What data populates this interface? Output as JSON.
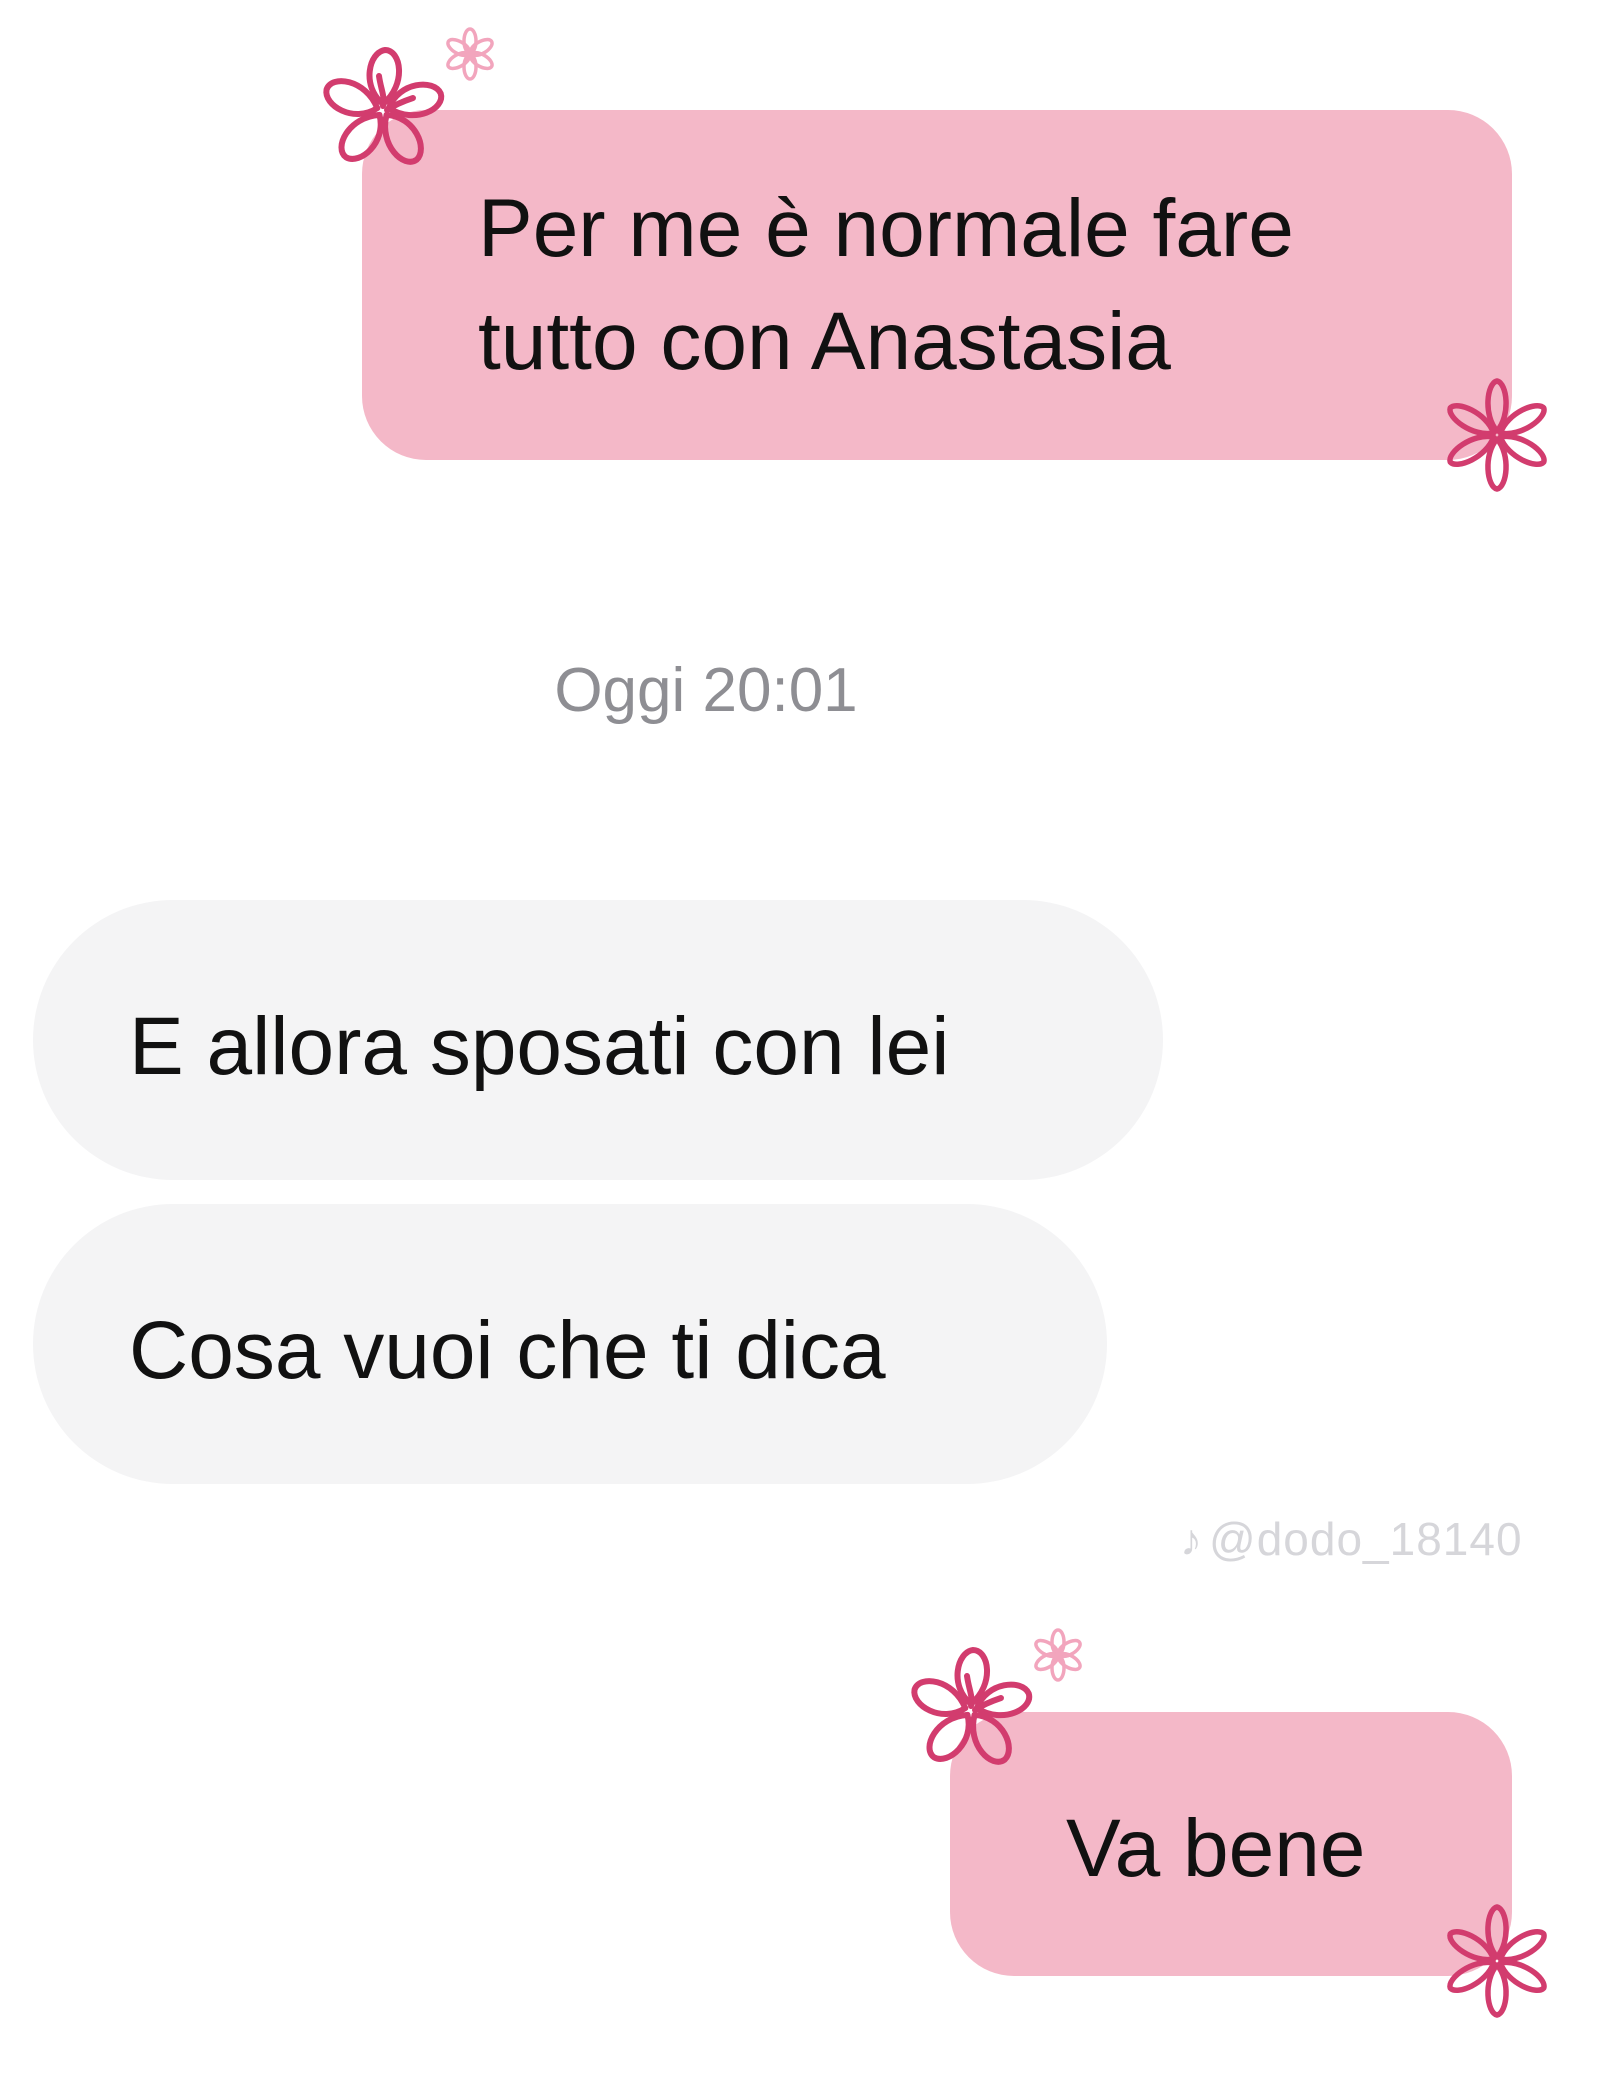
{
  "colors": {
    "outgoing_bubble": "#f4b8c8",
    "incoming_bubble": "#f4f4f5",
    "flower_dark": "#d23c6e",
    "flower_light": "#f2a5bd",
    "timestamp": "#8e8e93",
    "watermark": "#d6d6da"
  },
  "chat": {
    "messages": [
      {
        "direction": "outgoing",
        "text": "Per me è normale fare\ntutto con Anastasia"
      },
      {
        "direction": "incoming",
        "text": "E allora sposati con lei"
      },
      {
        "direction": "incoming",
        "text": "Cosa vuoi che ti dica"
      },
      {
        "direction": "outgoing",
        "text": "Va bene"
      }
    ],
    "timestamp": "Oggi 20:01"
  },
  "decorations": {
    "icons": [
      "flower-icon",
      "small-flower-icon",
      "tiktok-icon"
    ]
  },
  "watermark": {
    "text": "@dodo_18140"
  }
}
